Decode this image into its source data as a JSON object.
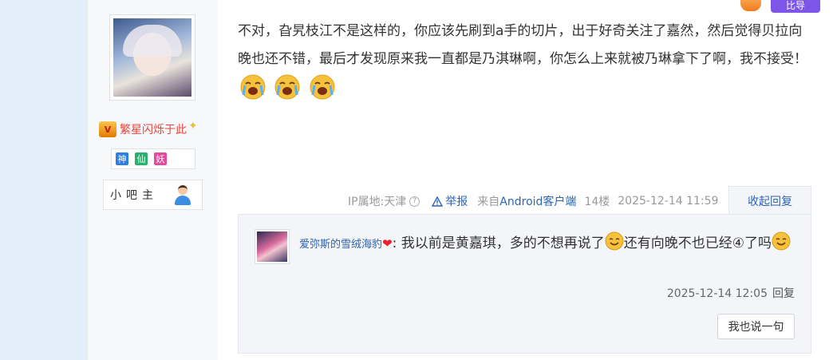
{
  "user": {
    "nickname": "繁星闪烁于此",
    "vip_icon": "vip-crown-icon",
    "badges": [
      {
        "label": "神",
        "color": "#2f7fe0"
      },
      {
        "label": "仙",
        "color": "#25b26c"
      },
      {
        "label": "妖",
        "color": "#e64a9e"
      }
    ],
    "role": "小吧主"
  },
  "top_badge": {
    "label": "比导"
  },
  "post": {
    "text": "不对，旮旯枝江不是这样的，你应该先刷到a手的切片，出于好奇关注了嘉然，然后觉得贝拉向晚也还不错，最后才发现原来我一直都是乃淇琳啊，你怎么上来就被乃琳拿下了啊，我不接受！",
    "emoji": "crying-face-icon",
    "emoji_count": 3
  },
  "meta": {
    "ip": "IP属地:天津",
    "report": "举报",
    "from_prefix": "来自",
    "client": "Android客户端",
    "floor": "14楼",
    "time": "2025-12-14 11:59",
    "collapse": "收起回复"
  },
  "reply": {
    "username": "爱弥斯的雪绒海豹",
    "colon": ":",
    "text_1": " 我以前是黄嘉琪，多的不想再说了",
    "text_2": "还有向晚不也已经④了吗",
    "emoji": "smile-face-icon",
    "time": "2025-12-14 12:05",
    "reply_label": "回复",
    "say_button": "我也说一句"
  },
  "colors": {
    "link": "#2d64b3",
    "nickname": "#e8453c",
    "side_bg": "#f7f8fa",
    "left_bg": "#e3eefb"
  }
}
